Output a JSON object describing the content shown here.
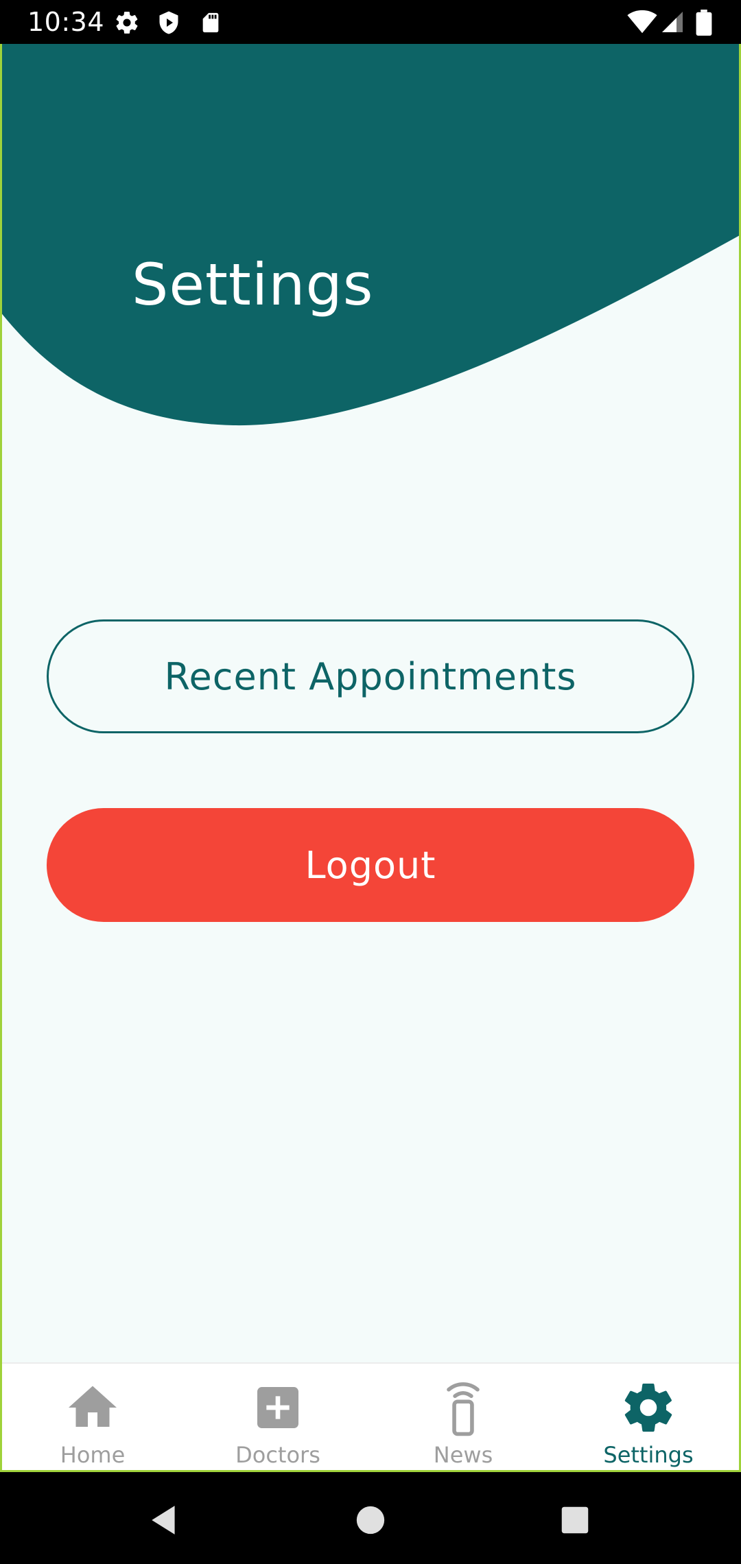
{
  "status_bar": {
    "time": "10:34",
    "icons": [
      "settings-icon",
      "shield-play-icon",
      "sd-card-icon"
    ],
    "right_icons": [
      "wifi-icon",
      "signal-icon",
      "battery-icon"
    ]
  },
  "header": {
    "title": "Settings",
    "color": "#0d6466"
  },
  "main": {
    "recent_appointments_label": "Recent Appointments",
    "logout_label": "Logout",
    "logout_color": "#f44538"
  },
  "bottom_nav": {
    "items": [
      {
        "label": "Home",
        "icon": "home-icon",
        "active": false
      },
      {
        "label": "Doctors",
        "icon": "medical-plus-icon",
        "active": false
      },
      {
        "label": "News",
        "icon": "phone-broadcast-icon",
        "active": false
      },
      {
        "label": "Settings",
        "icon": "gear-icon",
        "active": true
      }
    ]
  },
  "system_nav": {
    "icons": [
      "back-icon",
      "home-circle-icon",
      "recents-icon"
    ]
  }
}
